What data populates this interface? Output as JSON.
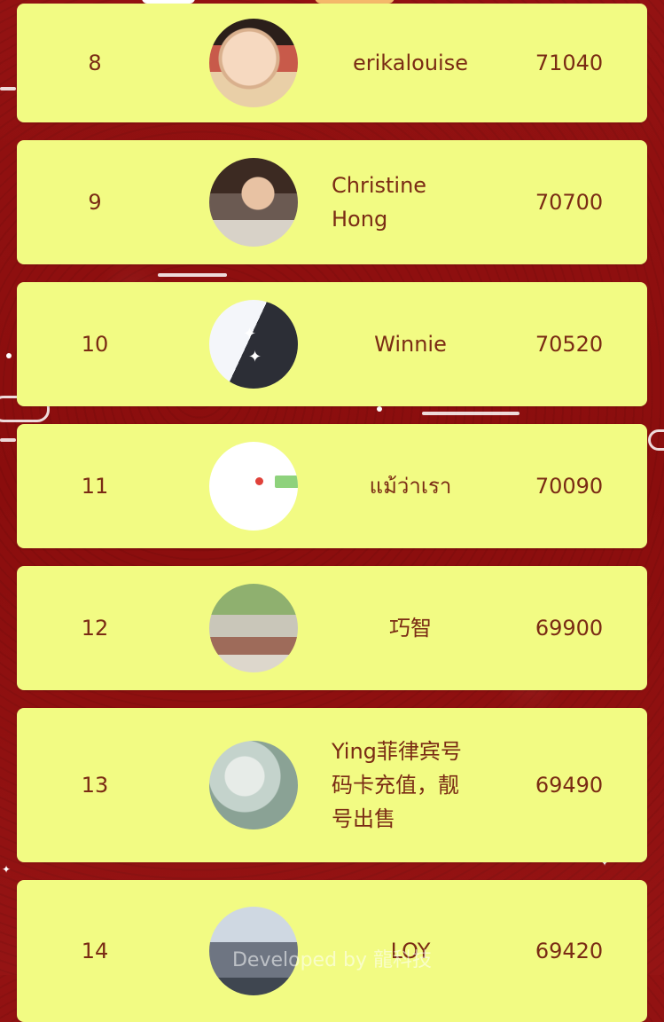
{
  "leaderboard": {
    "rows": [
      {
        "rank": "8",
        "name": "erikalouise",
        "score": "71040"
      },
      {
        "rank": "9",
        "name": "Christine Hong",
        "score": "70700"
      },
      {
        "rank": "10",
        "name": "Winnie",
        "score": "70520"
      },
      {
        "rank": "11",
        "name": "แม้ว่าเรา",
        "score": "70090"
      },
      {
        "rank": "12",
        "name": "巧智",
        "score": "69900"
      },
      {
        "rank": "13",
        "name": "Ying菲律宾号码卡充值，靓号出售",
        "score": "69490"
      },
      {
        "rank": "14",
        "name": "LOY",
        "score": "69420"
      }
    ]
  },
  "footer": {
    "credit": "Developed by 龍科技"
  },
  "colors": {
    "background": "#8e0f0f",
    "card": "#f2fb83",
    "text": "#7a2b14"
  }
}
